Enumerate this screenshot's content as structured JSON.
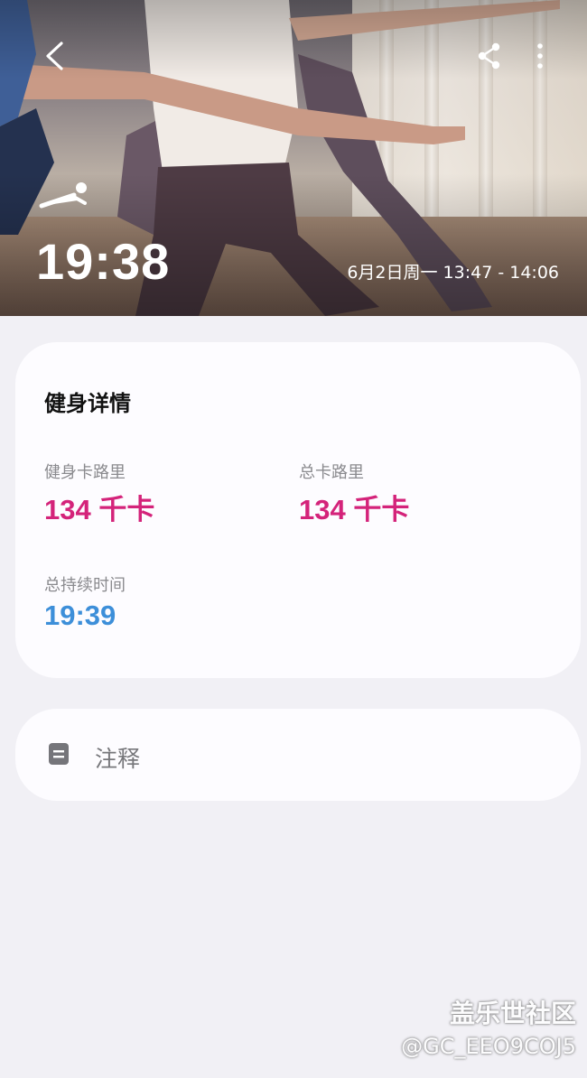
{
  "header": {
    "icons": {
      "back": "chevron-left-icon",
      "share": "share-icon",
      "more": "more-vertical-icon",
      "exercise": "plank-exercise-icon"
    },
    "duration": "19:38",
    "date_range": "6月2日周一 13:47 - 14:06"
  },
  "details": {
    "title": "健身详情",
    "workout_calories_label": "健身卡路里",
    "workout_calories_value": "134 千卡",
    "total_calories_label": "总卡路里",
    "total_calories_value": "134 千卡",
    "total_duration_label": "总持续时间",
    "total_duration_value": "19:39"
  },
  "notes": {
    "icon": "note-icon",
    "label": "注释"
  },
  "watermark": {
    "line1": "盖乐世社区",
    "line2": "@GC_EEO9COJ5"
  },
  "colors": {
    "calories": "#d4237a",
    "duration": "#3d8fd9",
    "background": "#f1f0f5",
    "card": "#fdfcff"
  }
}
